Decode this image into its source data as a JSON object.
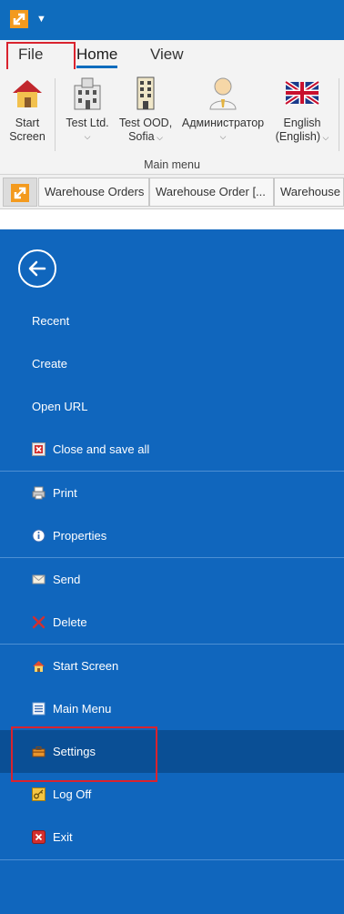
{
  "ribbon": {
    "tabs": [
      {
        "label": "File"
      },
      {
        "label": "Home"
      },
      {
        "label": "View"
      }
    ],
    "buttons": {
      "start_screen": {
        "line1": "Start",
        "line2": "Screen"
      },
      "test_ltd": {
        "line1": "Test Ltd."
      },
      "test_ood": {
        "line1": "Test OOD,",
        "line2": "Sofia"
      },
      "admin": {
        "line1": "Администратор"
      },
      "english": {
        "line1": "English",
        "line2": "(English)"
      }
    },
    "group_label": "Main menu"
  },
  "document_tabs": [
    {
      "label": "Warehouse Orders"
    },
    {
      "label": "Warehouse Order [..."
    },
    {
      "label": "Warehouse O"
    }
  ],
  "backstage": {
    "items": {
      "recent": "Recent",
      "create": "Create",
      "open_url": "Open URL",
      "close_save_all": "Close and save all",
      "print": "Print",
      "properties": "Properties",
      "send": "Send",
      "delete": "Delete",
      "start_screen": "Start Screen",
      "main_menu": "Main Menu",
      "settings": "Settings",
      "log_off": "Log Off",
      "exit": "Exit"
    },
    "selected": "Settings"
  },
  "colors": {
    "accent": "#0f6cbd",
    "backstage_bg": "#1066bd",
    "backstage_selected": "#0a4f95",
    "highlight_box": "#d9232e",
    "logo_orange": "#f39a1e"
  }
}
